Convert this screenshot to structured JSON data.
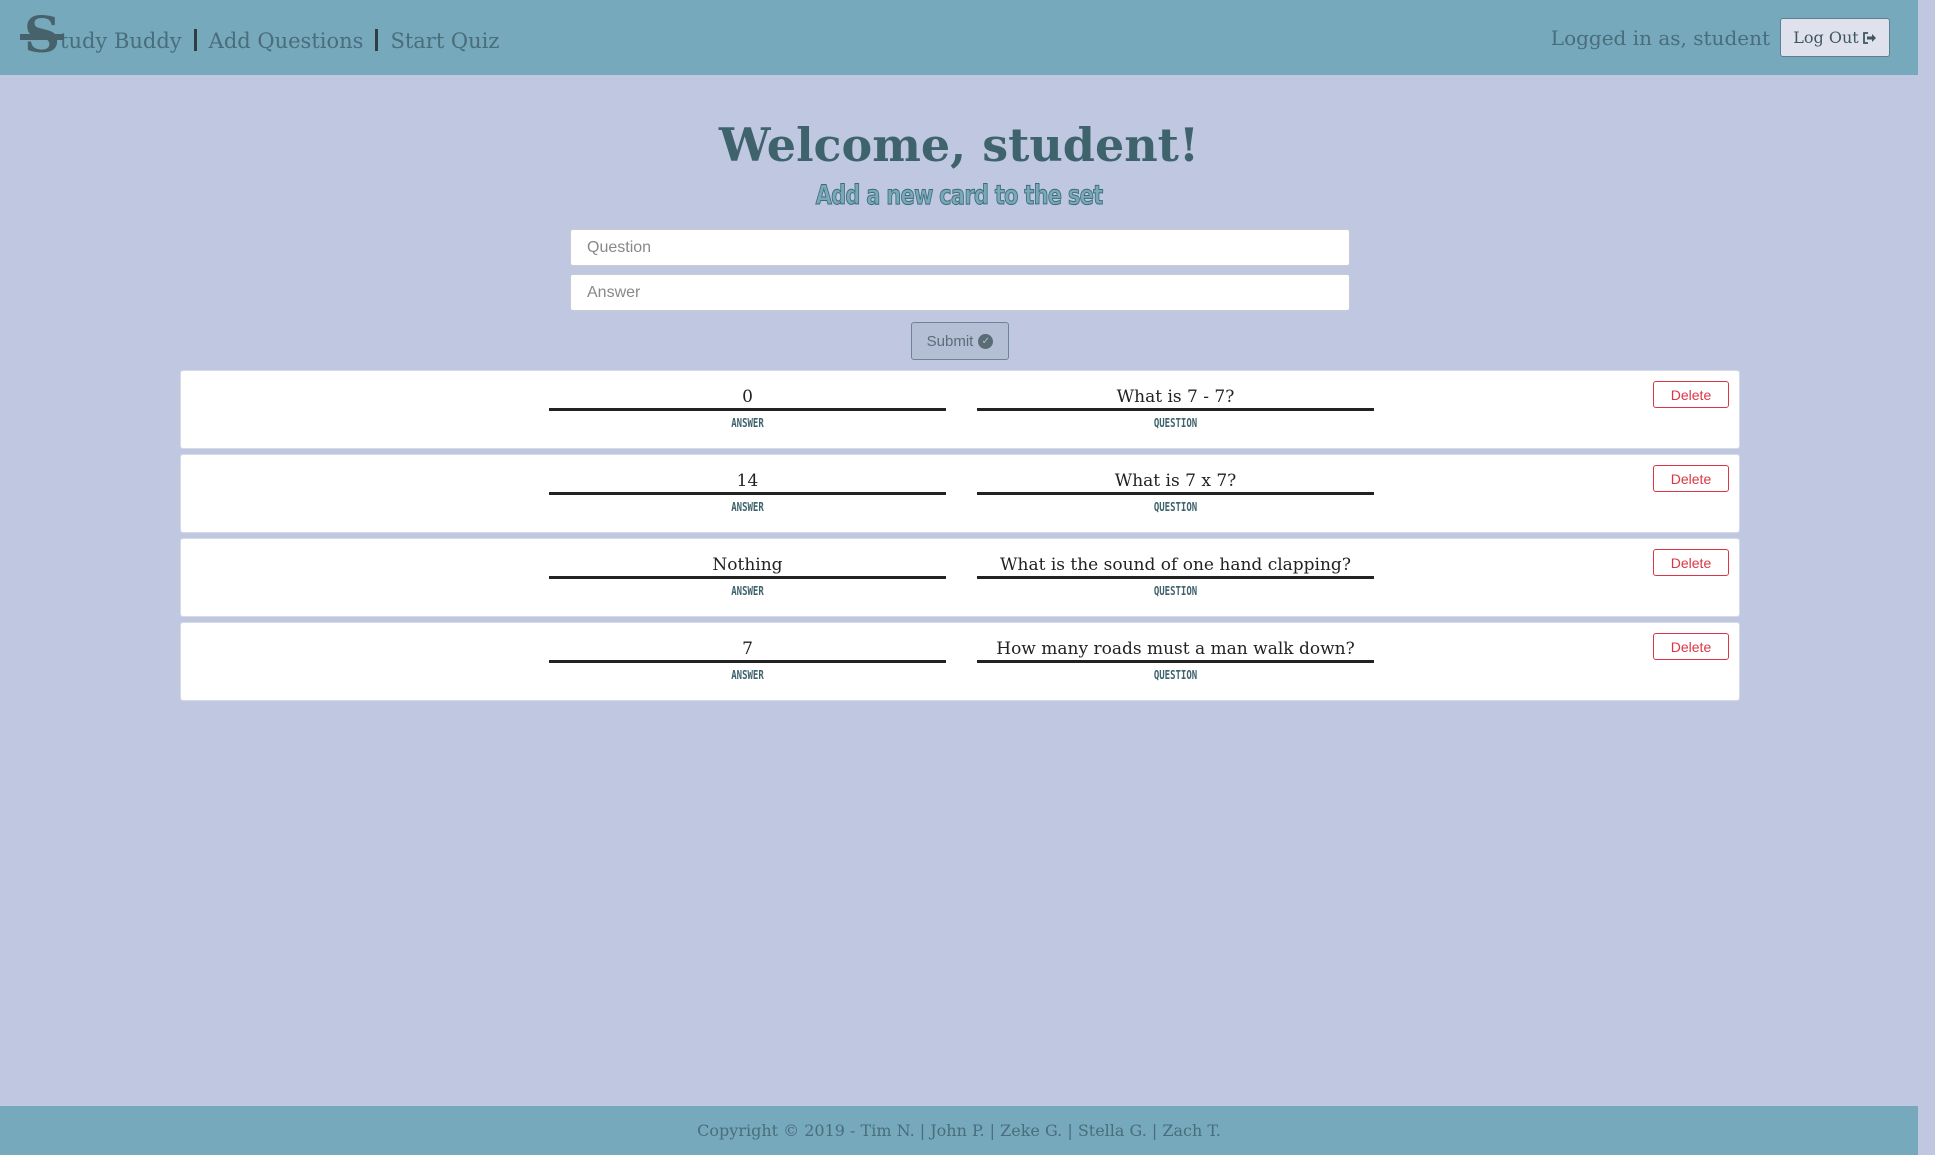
{
  "nav": {
    "logo_letter": "S",
    "brand_text": "tudy Buddy",
    "links": [
      "Add Questions",
      "Start Quiz"
    ],
    "logged_in_text": "Logged in as, student",
    "logout_label": "Log Out",
    "logout_icon": "sign-out-icon"
  },
  "main": {
    "welcome": "Welcome, student!",
    "subtitle": "Add a new card to the set",
    "question_placeholder": "Question",
    "answer_placeholder": "Answer",
    "submit_label": "Submit",
    "submit_icon": "check-circle-icon"
  },
  "cards": [
    {
      "answer": "0",
      "question": "What is 7 - 7?",
      "answer_label": "ANSWER",
      "question_label": "QUESTION",
      "delete_label": "Delete"
    },
    {
      "answer": "14",
      "question": "What is 7 x 7?",
      "answer_label": "ANSWER",
      "question_label": "QUESTION",
      "delete_label": "Delete"
    },
    {
      "answer": "Nothing",
      "question": "What is the sound of one hand clapping?",
      "answer_label": "ANSWER",
      "question_label": "QUESTION",
      "delete_label": "Delete"
    },
    {
      "answer": "7",
      "question": "How many roads must a man walk down?",
      "answer_label": "ANSWER",
      "question_label": "QUESTION",
      "delete_label": "Delete"
    }
  ],
  "footer": {
    "text": "Copyright © 2019 - Tim N. | John P. | Zeke G. | Stella G. | Zach T."
  },
  "colors": {
    "page_bg": "#bfc8e0",
    "nav_bg": "#76a9bc",
    "accent_text": "#3f636d",
    "delete": "#dc3545"
  }
}
